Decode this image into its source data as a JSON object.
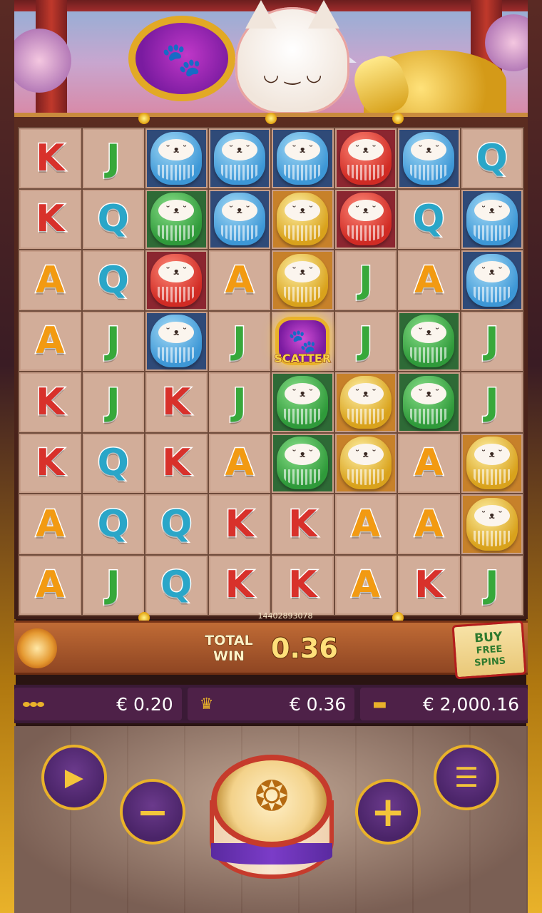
{
  "banner": {
    "scene": "maneki-neko-banner"
  },
  "grid": {
    "rows": [
      [
        "K",
        "J",
        "daruma-blue",
        "daruma-blue",
        "daruma-blue",
        "daruma-red",
        "daruma-blue",
        "Q"
      ],
      [
        "K",
        "Q",
        "daruma-green",
        "daruma-blue",
        "daruma-gold",
        "daruma-red",
        "Q",
        "daruma-blue"
      ],
      [
        "A",
        "Q",
        "daruma-red",
        "A",
        "daruma-gold",
        "J",
        "A",
        "daruma-blue"
      ],
      [
        "A",
        "J",
        "daruma-blue",
        "J",
        "scatter",
        "J",
        "daruma-green",
        "J"
      ],
      [
        "K",
        "J",
        "K",
        "J",
        "daruma-green",
        "daruma-gold",
        "daruma-green",
        "J"
      ],
      [
        "K",
        "Q",
        "K",
        "A",
        "daruma-green",
        "daruma-gold",
        "A",
        "daruma-gold"
      ],
      [
        "A",
        "Q",
        "Q",
        "K",
        "K",
        "A",
        "A",
        "daruma-gold"
      ],
      [
        "A",
        "J",
        "Q",
        "K",
        "K",
        "A",
        "K",
        "J"
      ]
    ],
    "scatter_label": "SCATTER",
    "round_id": "14402893078"
  },
  "win": {
    "label_line1": "TOTAL",
    "label_line2": "WIN",
    "value": "0.36"
  },
  "buy": {
    "line1": "BUY",
    "line2": "FREE",
    "line3": "SPINS"
  },
  "info": {
    "bet": "€ 0.20",
    "win": "€ 0.36",
    "balance": "€ 2,000.16"
  },
  "controls": {
    "autoplay_icon": "play-cycle-icon",
    "minus_icon": "minus-icon",
    "plus_icon": "plus-icon",
    "menu_icon": "menu-icon",
    "spin_icon": "drum-spin-icon"
  },
  "colors": {
    "accent_gold": "#e9b22a",
    "button_purple": "#4a2468",
    "K": "#d8312b",
    "J": "#37a83a",
    "Q": "#2aa6c8",
    "A": "#f29a12"
  }
}
